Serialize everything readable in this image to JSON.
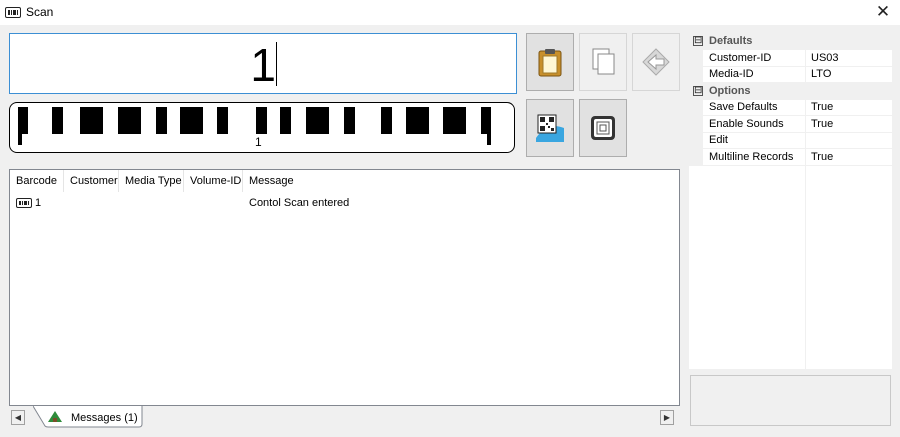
{
  "window": {
    "title": "Scan",
    "icon": "barcode-icon",
    "close_icon": "close-icon"
  },
  "scan": {
    "value": "1"
  },
  "barcode": {
    "text": "1"
  },
  "toolbar": {
    "buttons": [
      {
        "name": "paste-button",
        "icon": "clipboard-icon"
      },
      {
        "name": "copy-button",
        "icon": "copy-pages-icon"
      },
      {
        "name": "back-button",
        "icon": "back-arrow-icon"
      },
      {
        "name": "qr-code-button",
        "icon": "qr-code-icon"
      },
      {
        "name": "rfid-tag-button",
        "icon": "rfid-tag-icon"
      }
    ]
  },
  "list": {
    "columns": [
      "Barcode",
      "Customer",
      "Media Type",
      "Volume-ID",
      "Message"
    ],
    "rows": [
      {
        "barcode": "1",
        "customer": "",
        "media_type": "",
        "volume_id": "",
        "message": "Contol Scan entered"
      }
    ]
  },
  "tabs": [
    {
      "label": "Messages (1)",
      "icon": "messages-icon"
    }
  ],
  "properties": {
    "defaults": {
      "label": "Defaults",
      "items": [
        {
          "name": "Customer-ID",
          "value": "US03"
        },
        {
          "name": "Media-ID",
          "value": "LTO"
        }
      ]
    },
    "options": {
      "label": "Options",
      "items": [
        {
          "name": "Save Defaults",
          "value": "True"
        },
        {
          "name": "Enable Sounds",
          "value": "True"
        },
        {
          "name": "Edit",
          "value": ""
        },
        {
          "name": "Multiline Records",
          "value": "True"
        }
      ]
    },
    "collapse_glyph": "⊟"
  },
  "colors": {
    "accent": "#3c8fd4",
    "border": "#adadad"
  }
}
